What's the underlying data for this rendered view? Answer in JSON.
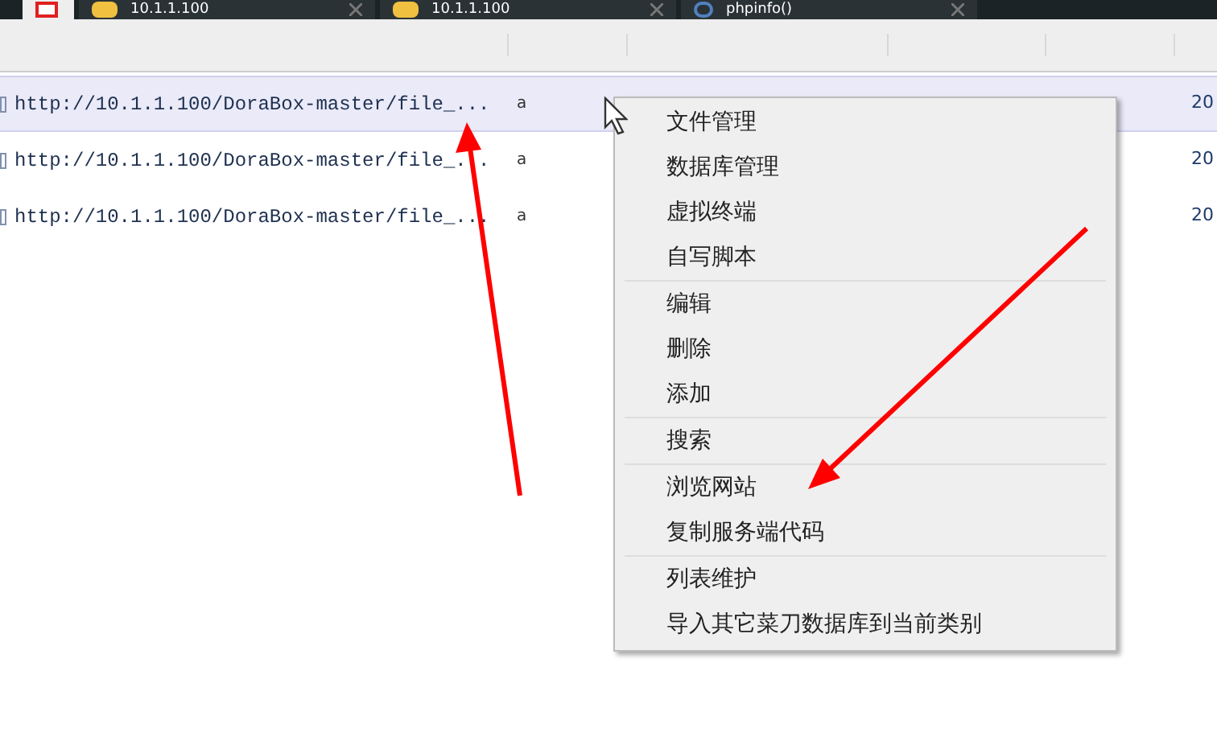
{
  "tabs": [
    {
      "kind": "home",
      "selected": true
    },
    {
      "kind": "folder",
      "label": "10.1.1.100",
      "selected": false
    },
    {
      "kind": "folder",
      "label": "10.1.1.100",
      "selected": false
    },
    {
      "kind": "page",
      "label": "phpinfo()",
      "selected": false
    }
  ],
  "table": {
    "rows": [
      {
        "url": "http://10.1.1.100/DoraBox-master/file_...",
        "column_2": "a",
        "column_3": "20",
        "selected": true
      },
      {
        "url": "http://10.1.1.100/DoraBox-master/file_...",
        "column_2": "a",
        "column_3": "20",
        "selected": false
      },
      {
        "url": "http://10.1.1.100/DoraBox-master/file_...",
        "column_2": "a",
        "column_3": "20",
        "selected": false
      }
    ]
  },
  "context_menu": {
    "groups": [
      [
        "文件管理",
        "数据库管理",
        "虚拟终端",
        "自写脚本"
      ],
      [
        "编辑",
        "删除",
        "添加"
      ],
      [
        "搜索"
      ],
      [
        "浏览网站",
        "复制服务端代码"
      ],
      [
        "列表维护",
        "导入其它菜刀数据库到当前类别"
      ]
    ]
  }
}
